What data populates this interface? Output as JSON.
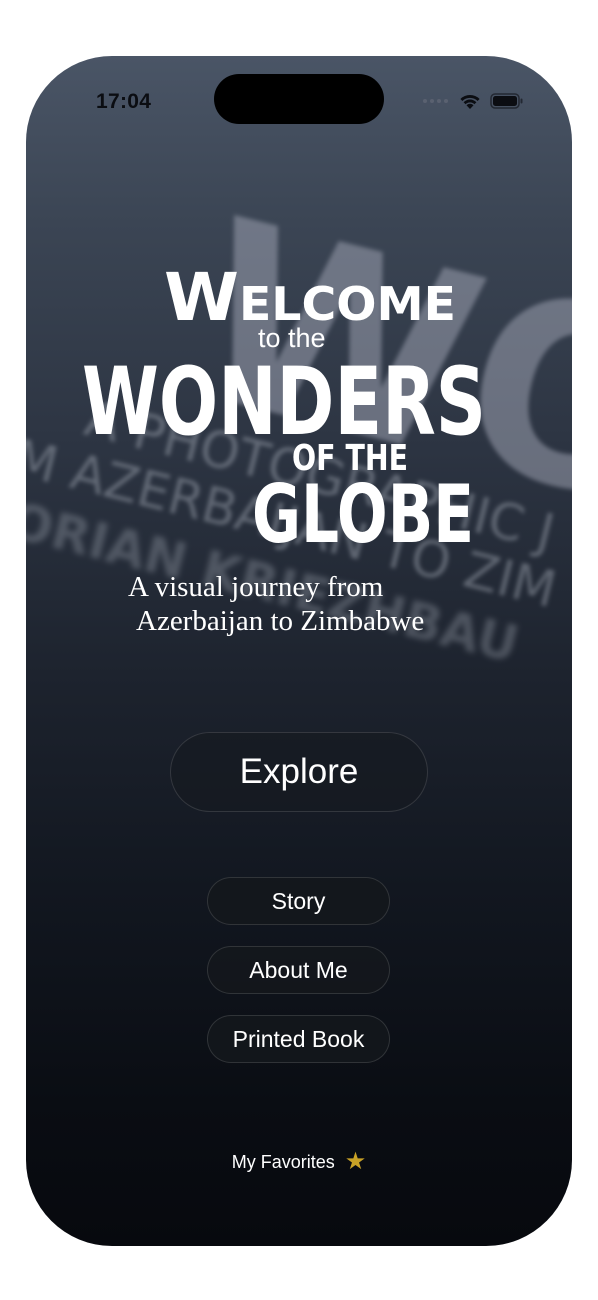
{
  "status_bar": {
    "time": "17:04"
  },
  "hero": {
    "title_line1": "Welcome",
    "title_line2": "to the",
    "title_line3": "Wonders",
    "title_line4": "of the",
    "title_line5": "Globe",
    "subtitle_line1": "A visual journey from",
    "subtitle_line2": "Azerbaijan to Zimbabwe"
  },
  "background_text": {
    "line1": "WO",
    "line2": "A PHOTOGRAPHIC J",
    "line3": "M AZERBAIJAN TO ZIM",
    "line4": "ORIAN KRIEZHBAU"
  },
  "buttons": {
    "explore": "Explore",
    "story": "Story",
    "about": "About Me",
    "book": "Printed Book"
  },
  "favorites": {
    "label": "My Favorites",
    "icon": "star-icon"
  },
  "colors": {
    "star": "#c9a227",
    "text": "#ffffff"
  }
}
